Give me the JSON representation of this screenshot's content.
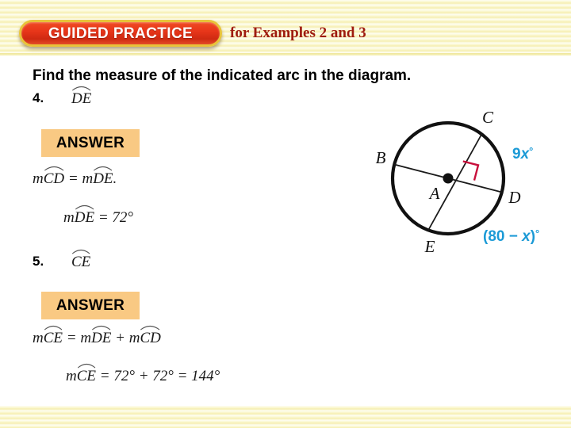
{
  "header": {
    "badge_label": "GUIDED PRACTICE",
    "examples_label": "for Examples 2 and 3"
  },
  "body": {
    "prompt": "Find the measure of the indicated arc in the diagram.",
    "questions": [
      {
        "number": "4.",
        "arc_term": "DE",
        "answer_label": "ANSWER",
        "solution_lines": [
          {
            "prefix": "m",
            "arc1": "CD",
            "middle": " = ",
            "prefix2": "m",
            "arc2": "DE",
            "suffix": "."
          },
          {
            "prefix": "m",
            "arc1": "DE",
            "middle": " = ",
            "value": "72°"
          }
        ]
      },
      {
        "number": "5.",
        "arc_term": "CE",
        "answer_label": "ANSWER",
        "solution_lines": [
          {
            "prefix": "m",
            "arc1": "CE",
            "middle": " = ",
            "prefix2": "m",
            "arc2": "DE",
            "plus": " + ",
            "prefix3": "m",
            "arc3": "CD"
          },
          {
            "prefix": "m",
            "arc1": "CE",
            "middle": " = ",
            "value": "72° + 72° = 144°"
          }
        ]
      }
    ]
  },
  "diagram": {
    "points": {
      "center": "A",
      "b": "B",
      "c": "C",
      "d": "D",
      "e": "E"
    },
    "arc_labels": {
      "upper": "9x°",
      "lower": "(80 − x)°"
    },
    "upper_coef": "9",
    "upper_var": "x",
    "upper_deg": "°",
    "lower_open": "(80 − ",
    "lower_var": "x",
    "lower_close": ")",
    "lower_deg": "°",
    "colors": {
      "stroke": "#111111",
      "chord": "#1a1a1a",
      "right_angle": "#c8103c",
      "expression": "#1b9ad6"
    }
  },
  "theme": {
    "band": "#fbf8d0",
    "badge_fill": "#e03a18",
    "badge_border": "#e8c33a",
    "answer_fill": "#f9c983",
    "examples_text": "#9e1b10"
  }
}
